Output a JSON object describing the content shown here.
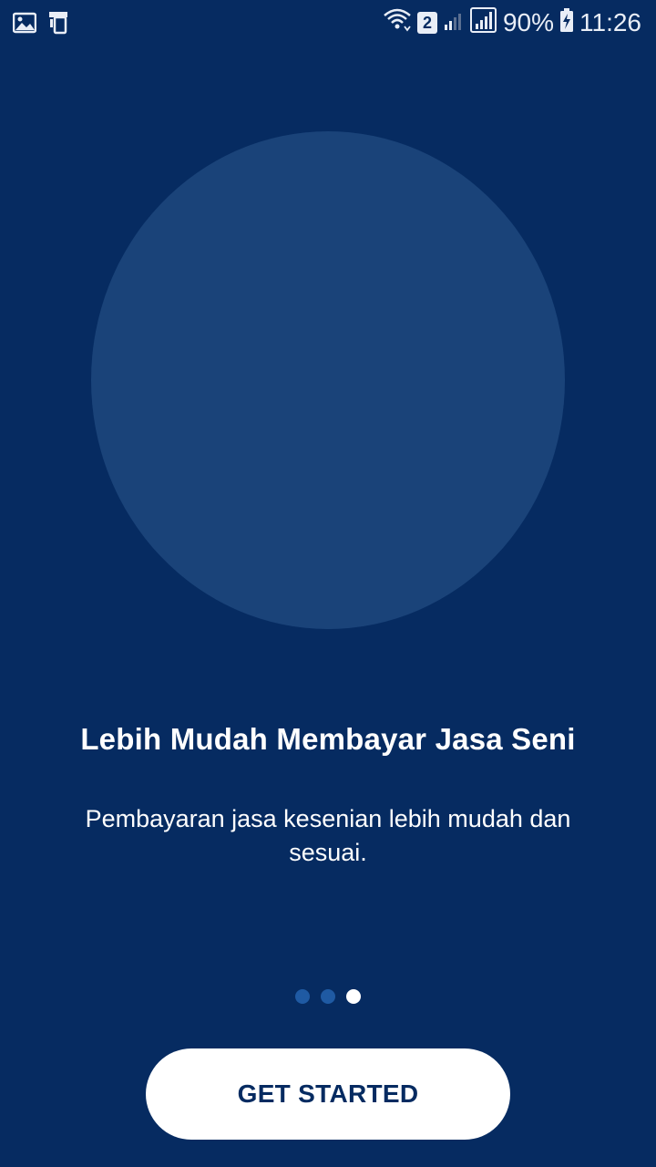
{
  "status_bar": {
    "left_icons": [
      "image-icon",
      "transfer-icon"
    ],
    "right_icons": [
      "wifi-icon",
      "sim2-badge",
      "signal-weak-icon",
      "signal-icon",
      "battery-charging-icon"
    ],
    "sim_label": "2",
    "battery": "90%",
    "time": "11:26"
  },
  "onboarding": {
    "title": "Lebih Mudah Membayar Jasa Seni",
    "description": "Pembayaran jasa kesenian lebih mudah dan sesuai.",
    "pager": {
      "total": 3,
      "active": 3
    },
    "cta_label": "GET STARTED"
  },
  "colors": {
    "background": "#062b61",
    "circle": "#1a4379",
    "dot_inactive": "#1f5aa3",
    "dot_active": "#ffffff",
    "button_bg": "#ffffff",
    "button_text": "#062b61"
  }
}
